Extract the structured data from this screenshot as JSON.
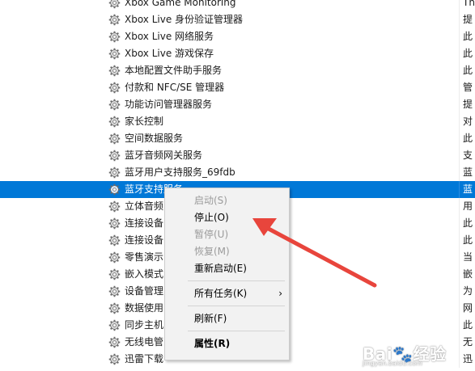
{
  "services": [
    {
      "name": "Xbox Game Monitoring",
      "desc": "Th"
    },
    {
      "name": "Xbox Live 身份验证管理器",
      "desc": "提"
    },
    {
      "name": "Xbox Live 网络服务",
      "desc": "此"
    },
    {
      "name": "Xbox Live 游戏保存",
      "desc": "此"
    },
    {
      "name": "本地配置文件助手服务",
      "desc": "此"
    },
    {
      "name": "付款和 NFC/SE 管理器",
      "desc": "管"
    },
    {
      "name": "功能访问管理器服务",
      "desc": "提"
    },
    {
      "name": "家长控制",
      "desc": "对"
    },
    {
      "name": "空间数据服务",
      "desc": "此"
    },
    {
      "name": "蓝牙音频网关服务",
      "desc": "支"
    },
    {
      "name": "蓝牙用户支持服务_69fdb",
      "desc": "蓝"
    },
    {
      "name": "蓝牙支持服务",
      "desc": "蓝",
      "selected": true
    },
    {
      "name": "立体音频",
      "desc": "用"
    },
    {
      "name": "连接设备",
      "desc": "此"
    },
    {
      "name": "连接设备",
      "desc": "此"
    },
    {
      "name": "零售演示",
      "desc": "当"
    },
    {
      "name": "嵌入模式",
      "desc": "嵌"
    },
    {
      "name": "设备管理",
      "desc": "为"
    },
    {
      "name": "数据使用",
      "desc": "网"
    },
    {
      "name": "同步主机",
      "desc": "此"
    },
    {
      "name": "无线电管",
      "desc": "无"
    },
    {
      "name": "迅雷下载",
      "desc": "迅"
    }
  ],
  "context_menu": {
    "items": [
      {
        "label": "启动(S)",
        "disabled": true
      },
      {
        "label": "停止(O)"
      },
      {
        "label": "暂停(U)",
        "disabled": true
      },
      {
        "label": "恢复(M)",
        "disabled": true
      },
      {
        "label": "重新启动(E)"
      },
      {
        "separator": true
      },
      {
        "label": "所有任务(K)",
        "submenu": true
      },
      {
        "separator": true
      },
      {
        "label": "刷新(F)"
      },
      {
        "separator": true
      },
      {
        "label": "属性(R)",
        "bold": true
      }
    ]
  },
  "annotation": {
    "color": "#e8453c",
    "points_to": "停止(O)"
  },
  "colors": {
    "selection": "#0078d7",
    "menu_bg": "#f2f2f2",
    "disabled_text": "#9b9b9b"
  },
  "watermark": {
    "brand": "Bai",
    "suffix": "经验",
    "url": "jingyan.baidu.com"
  }
}
